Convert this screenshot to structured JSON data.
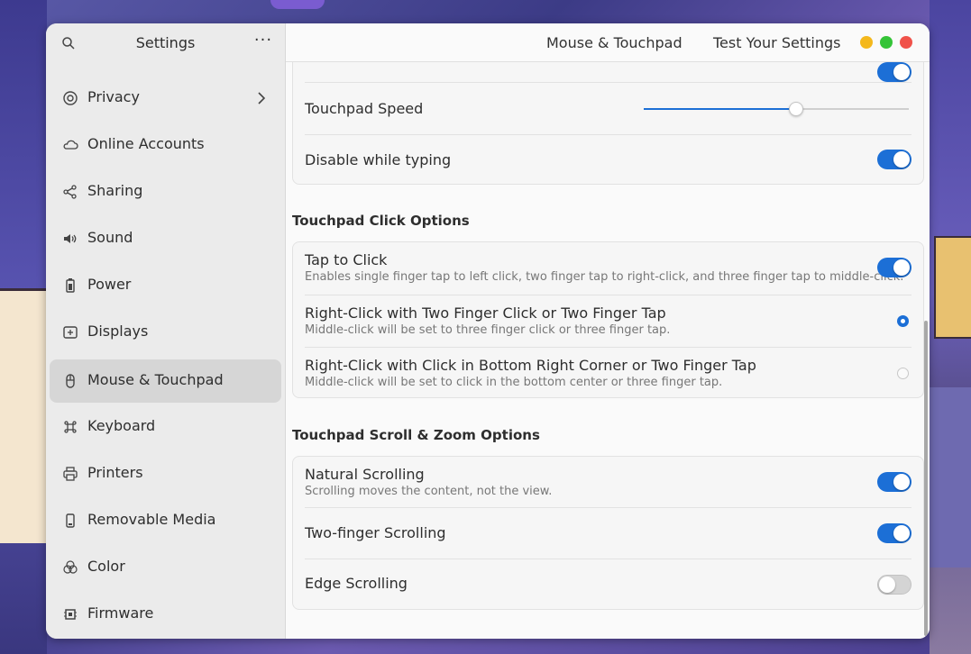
{
  "sidebar": {
    "title": "Settings",
    "menu_label": "···",
    "items": [
      {
        "label": "Privacy",
        "icon": "privacy-icon"
      },
      {
        "label": "Online Accounts",
        "icon": "cloud-icon"
      },
      {
        "label": "Sharing",
        "icon": "share-icon"
      },
      {
        "label": "Sound",
        "icon": "speaker-icon"
      },
      {
        "label": "Power",
        "icon": "battery-icon"
      },
      {
        "label": "Displays",
        "icon": "display-icon"
      },
      {
        "label": "Mouse & Touchpad",
        "icon": "mouse-icon",
        "active": true
      },
      {
        "label": "Keyboard",
        "icon": "command-key-icon"
      },
      {
        "label": "Printers",
        "icon": "printer-icon"
      },
      {
        "label": "Removable Media",
        "icon": "usb-drive-icon"
      },
      {
        "label": "Color",
        "icon": "color-circles-icon"
      },
      {
        "label": "Firmware",
        "icon": "chip-icon"
      }
    ]
  },
  "header": {
    "title": "Mouse & Touchpad",
    "test_button": "Test Your Settings"
  },
  "touchpad_general": {
    "speed_label": "Touchpad Speed",
    "speed_value": 0.57,
    "disable_typing_label": "Disable while typing",
    "disable_typing_on": true
  },
  "click_options": {
    "section_title": "Touchpad Click Options",
    "tap_to_click": {
      "title": "Tap to Click",
      "subtitle": "Enables single finger tap to left click, two finger tap to right-click, and three finger tap to middle-click.",
      "on": true
    },
    "right_click_two_finger": {
      "title": "Right-Click with Two Finger Click or Two Finger Tap",
      "subtitle": "Middle-click will be set to three finger click or three finger tap.",
      "selected": true
    },
    "right_click_corner": {
      "title": "Right-Click with Click in Bottom Right Corner or Two Finger Tap",
      "subtitle": "Middle-click will be set to click in the bottom center or three finger tap.",
      "selected": false
    }
  },
  "scroll_options": {
    "section_title": "Touchpad Scroll & Zoom Options",
    "natural": {
      "title": "Natural Scrolling",
      "subtitle": "Scrolling moves the content, not the view.",
      "on": true
    },
    "two_finger": {
      "title": "Two-finger Scrolling",
      "on": true
    },
    "edge": {
      "title": "Edge Scrolling",
      "on": false
    }
  },
  "colors": {
    "accent": "#1c6fd6"
  }
}
